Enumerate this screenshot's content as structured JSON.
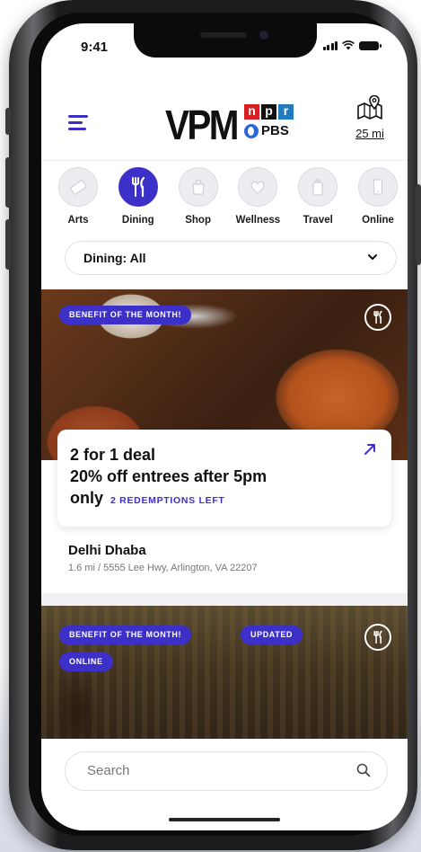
{
  "status_bar": {
    "time": "9:41"
  },
  "header": {
    "logo_primary": "VPM",
    "logo_npr": [
      "n",
      "p",
      "r"
    ],
    "logo_pbs": "PBS",
    "distance": "25 mi"
  },
  "categories": [
    {
      "label": "Arts",
      "icon": "ticket-icon",
      "active": false
    },
    {
      "label": "Dining",
      "icon": "fork-knife-icon",
      "active": true
    },
    {
      "label": "Shop",
      "icon": "shopping-bag-icon",
      "active": false
    },
    {
      "label": "Wellness",
      "icon": "heart-icon",
      "active": false
    },
    {
      "label": "Travel",
      "icon": "luggage-icon",
      "active": false
    },
    {
      "label": "Online",
      "icon": "phone-icon",
      "active": false
    }
  ],
  "filter": {
    "selected": "Dining: All"
  },
  "offers": [
    {
      "badges": [
        "BENEFIT OF THE MONTH!"
      ],
      "deal_line1": "2 for 1 deal",
      "deal_line2": "20% off entrees after 5pm",
      "deal_line3": "only",
      "redemptions": "2 REDEMPTIONS LEFT",
      "merchant": "Delhi Dhaba",
      "address": "1.6 mi / 5555 Lee Hwy, Arlington, VA 22207"
    },
    {
      "badges": [
        "BENEFIT OF THE MONTH!",
        "UPDATED",
        "ONLINE"
      ]
    }
  ],
  "search": {
    "placeholder": "Search"
  },
  "colors": {
    "accent": "#3d30c9",
    "background": "#ffffff",
    "text": "#111111"
  }
}
